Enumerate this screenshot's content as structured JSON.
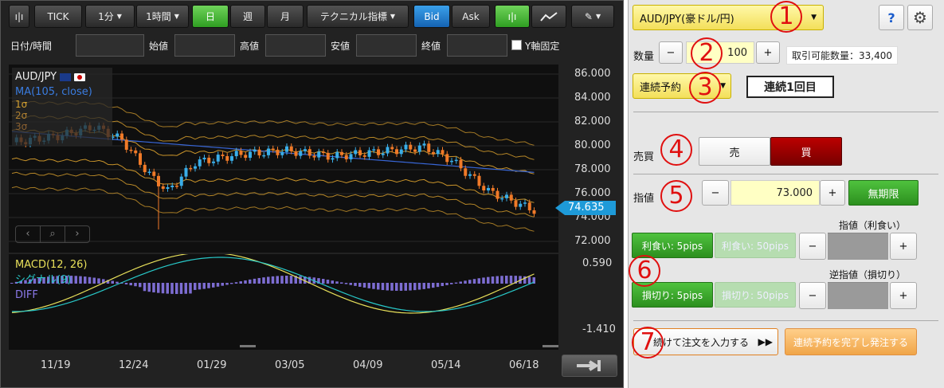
{
  "toolbar": {
    "tick": "TICK",
    "interval_min": "1分",
    "interval_hour": "1時間",
    "day": "日",
    "week": "週",
    "month": "月",
    "tech": "テクニカル指標",
    "bid": "Bid",
    "ask": "Ask"
  },
  "info_bar": {
    "datetime": "日付/時間",
    "open": "始値",
    "high": "高値",
    "low": "安値",
    "close": "終値",
    "y_fixed": "Y軸固定"
  },
  "chart": {
    "symbol": "AUD/JPY",
    "legend_ma": "MA(105, close)",
    "legend_1s": "1σ",
    "legend_2s": "2σ",
    "legend_3s": "3σ",
    "current_price": "74.635",
    "price_axis": [
      "86.000",
      "84.000",
      "82.000",
      "80.000",
      "78.000",
      "76.000",
      "74.000",
      "72.000"
    ],
    "macd_legend": "MACD(12, 26)",
    "signal_legend": "シグナル(9)",
    "diff_legend": "DIFF",
    "macd_max": "0.590",
    "macd_min": "-1.410",
    "date_axis": [
      "11/19",
      "12/24",
      "01/29",
      "03/05",
      "04/09",
      "05/14",
      "06/18"
    ],
    "colors": {
      "up": "#3aaee8",
      "down": "#f07a28",
      "ma": "#3866d6",
      "band": "#c8932a",
      "macd": "#e8e05a",
      "signal": "#28c8c8",
      "diff": "#8a78e8",
      "price_tag": "#1e9ad8"
    }
  },
  "panel": {
    "pair": "AUD/JPY(豪ドル/円)",
    "help": "?",
    "qty_label": "数量",
    "qty_value": "100",
    "minus": "−",
    "plus": "+",
    "tradable": "取引可能数量：33,400",
    "order_type": "連続予約",
    "sequence": "連続1回目",
    "side_label": "売買",
    "sell": "売",
    "buy": "買",
    "limit_label": "指値",
    "limit_value": "73.000",
    "unlimited": "無期限",
    "tp_header": "指値（利食い）",
    "tp_active": "利食い: 5pips",
    "tp_inactive": "利食い: 50pips",
    "sl_header": "逆指値（損切り）",
    "sl_active": "損切り: 5pips",
    "sl_inactive": "損切り: 50pips",
    "continue": "続けて注文を入力する",
    "continue_arrows": "▶▶",
    "complete": "連続予約を完了し発注する",
    "callouts": [
      "1",
      "2",
      "3",
      "4",
      "5",
      "6",
      "7"
    ]
  }
}
